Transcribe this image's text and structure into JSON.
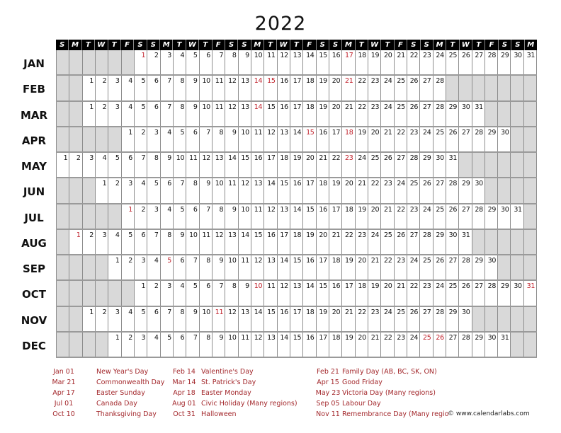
{
  "title": "2022",
  "weekday_header": [
    "S",
    "M",
    "T",
    "W",
    "T",
    "F",
    "S",
    "S",
    "M",
    "T",
    "W",
    "T",
    "F",
    "S",
    "S",
    "M",
    "T",
    "W",
    "T",
    "F",
    "S",
    "S",
    "M",
    "T",
    "W",
    "T",
    "F",
    "S",
    "S",
    "M",
    "T",
    "W",
    "T",
    "F",
    "S",
    "S",
    "M"
  ],
  "months": [
    {
      "label": "JAN",
      "offset": 6,
      "days": 31,
      "red": [
        1,
        17
      ]
    },
    {
      "label": "FEB",
      "offset": 2,
      "days": 28,
      "red": [
        14,
        15,
        21
      ]
    },
    {
      "label": "MAR",
      "offset": 2,
      "days": 31,
      "red": [
        14
      ]
    },
    {
      "label": "APR",
      "offset": 5,
      "days": 30,
      "red": [
        15,
        18
      ]
    },
    {
      "label": "MAY",
      "offset": 0,
      "days": 31,
      "red": [
        23
      ]
    },
    {
      "label": "JUN",
      "offset": 3,
      "days": 30,
      "red": []
    },
    {
      "label": "JUL",
      "offset": 5,
      "days": 31,
      "red": [
        1
      ]
    },
    {
      "label": "AUG",
      "offset": 1,
      "days": 31,
      "red": [
        1
      ]
    },
    {
      "label": "SEP",
      "offset": 4,
      "days": 30,
      "red": [
        5
      ]
    },
    {
      "label": "OCT",
      "offset": 6,
      "days": 31,
      "red": [
        10,
        31
      ]
    },
    {
      "label": "NOV",
      "offset": 2,
      "days": 30,
      "red": [
        11
      ]
    },
    {
      "label": "DEC",
      "offset": 4,
      "days": 31,
      "red": [
        25,
        26
      ]
    }
  ],
  "holidays": {
    "col1": [
      {
        "date": "Jan 01",
        "name": "New Year's Day"
      },
      {
        "date": "Mar 21",
        "name": "Commonwealth Day"
      },
      {
        "date": "Apr 17",
        "name": "Easter Sunday"
      },
      {
        "date": "Jul 01",
        "name": "Canada Day"
      },
      {
        "date": "Oct 10",
        "name": "Thanksgiving Day"
      }
    ],
    "col2": [
      {
        "date": "Feb 14",
        "name": "Valentine's Day"
      },
      {
        "date": "Mar 14",
        "name": "St. Patrick's Day"
      },
      {
        "date": "Apr 18",
        "name": "Easter Monday"
      },
      {
        "date": "Aug 01",
        "name": "Civic Holiday (Many regions)"
      },
      {
        "date": "Oct 31",
        "name": "Halloween"
      }
    ],
    "col3": [
      {
        "date": "Feb 21",
        "name": "Family Day (AB, BC, SK, ON)"
      },
      {
        "date": "Apr 15",
        "name": "Good Friday"
      },
      {
        "date": "May 23",
        "name": "Victoria Day (Many regions)"
      },
      {
        "date": "Sep 05",
        "name": "Labour Day"
      },
      {
        "date": "Nov 11",
        "name": "Remembrance Day (Many regio"
      }
    ]
  },
  "copyright": "© www.calendarlabs.com",
  "colors": {
    "holiday_red": "#c0202a",
    "empty_cell": "#d9d9d9",
    "legend_text": "#a3282c"
  }
}
